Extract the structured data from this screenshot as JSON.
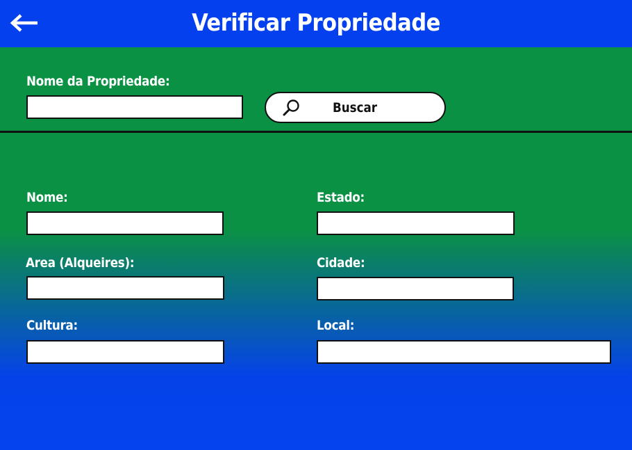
{
  "header": {
    "title": "Verificar Propriedade",
    "back_icon": "arrow-left-icon"
  },
  "search": {
    "label": "Nome da Propriedade:",
    "value": "",
    "button_label": "Buscar",
    "button_icon": "search-icon"
  },
  "form": {
    "nome_label": "Nome:",
    "estado_label": "Estado:",
    "area_label": "Area (Alqueires):",
    "cidade_label": "Cidade:",
    "cultura_label": "Cultura:",
    "local_label": "Local:"
  },
  "colors": {
    "header_bg": "#0440ee",
    "green": "#0b9144",
    "blue": "#0543ee"
  }
}
